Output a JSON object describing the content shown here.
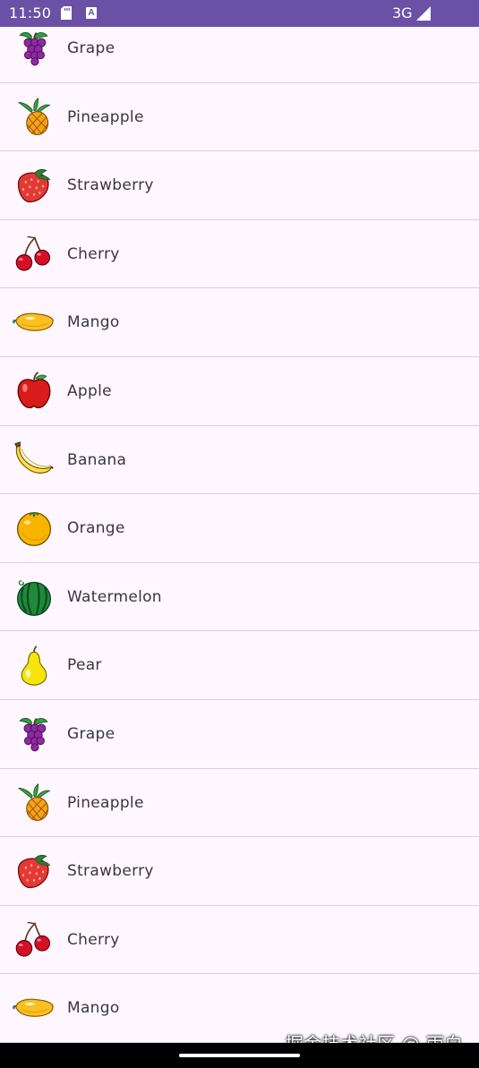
{
  "status_bar": {
    "time": "11:50",
    "network": "3G",
    "background": "#6a51a6"
  },
  "fruits": [
    {
      "name": "Grape",
      "icon": "grape-icon"
    },
    {
      "name": "Pineapple",
      "icon": "pineapple-icon"
    },
    {
      "name": "Strawberry",
      "icon": "strawberry-icon"
    },
    {
      "name": "Cherry",
      "icon": "cherry-icon"
    },
    {
      "name": "Mango",
      "icon": "mango-icon"
    },
    {
      "name": "Apple",
      "icon": "apple-icon"
    },
    {
      "name": "Banana",
      "icon": "banana-icon"
    },
    {
      "name": "Orange",
      "icon": "orange-icon"
    },
    {
      "name": "Watermelon",
      "icon": "watermelon-icon"
    },
    {
      "name": "Pear",
      "icon": "pear-icon"
    },
    {
      "name": "Grape",
      "icon": "grape-icon"
    },
    {
      "name": "Pineapple",
      "icon": "pineapple-icon"
    },
    {
      "name": "Strawberry",
      "icon": "strawberry-icon"
    },
    {
      "name": "Cherry",
      "icon": "cherry-icon"
    },
    {
      "name": "Mango",
      "icon": "mango-icon"
    }
  ],
  "watermark": "掘金技术社区 @ 雨白"
}
